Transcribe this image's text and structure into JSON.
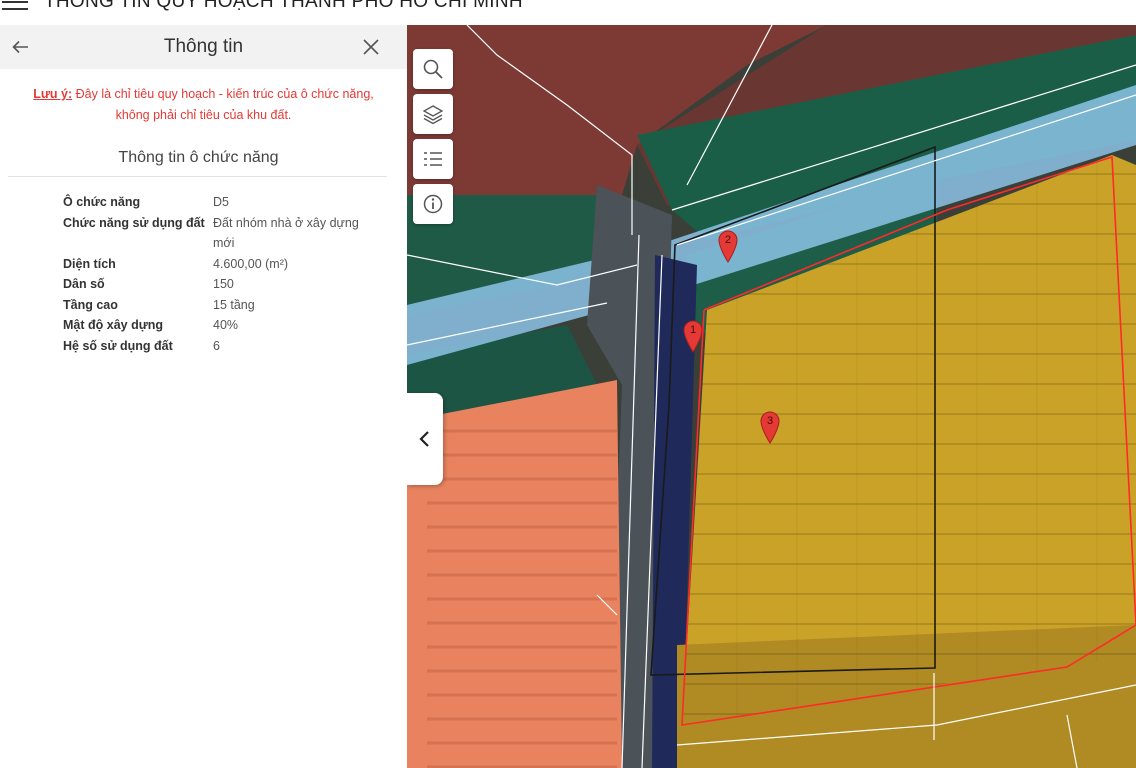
{
  "app": {
    "title": "THÔNG TIN QUY HOẠCH THÀNH PHỐ HỒ CHÍ MINH"
  },
  "panel": {
    "title": "Thông tin",
    "note": {
      "label": "Lưu ý:",
      "text_line1": "Đây là chỉ tiêu quy hoạch - kiến trúc của ô chức năng,",
      "text_line2": "không phải chỉ tiêu của khu đất."
    },
    "section_title": "Thông tin ô chức năng",
    "rows": [
      {
        "key": "Ô chức năng",
        "value": "D5"
      },
      {
        "key": "Chức năng sử dụng đất",
        "value": "Đất nhóm nhà ở xây dựng mới"
      },
      {
        "key": "Diện tích",
        "value": "4.600,00 (m²)"
      },
      {
        "key": "Dân số",
        "value": "150"
      },
      {
        "key": "Tầng cao",
        "value": "15 tầng"
      },
      {
        "key": "Mật độ xây dựng",
        "value": "40%"
      },
      {
        "key": "Hệ số sử dụng đất",
        "value": "6"
      }
    ]
  },
  "map": {
    "tools": [
      "search-icon",
      "layers-icon",
      "list-icon",
      "info-icon"
    ],
    "markers": [
      "1",
      "2",
      "3"
    ],
    "colors": {
      "residential": "#c9a227",
      "commercial": "#e8825f",
      "green": "#1f5e4a",
      "water": "#8cc3e6",
      "mixed": "#8a3a36",
      "parcel_border": "#ff2a2a",
      "marker": "#e53935"
    }
  }
}
